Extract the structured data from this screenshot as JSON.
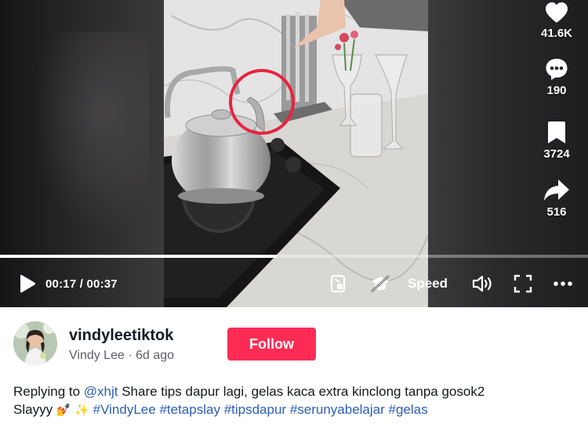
{
  "video": {
    "elapsed": "00:17",
    "separator": " / ",
    "duration": "00:37",
    "progress": 0.47,
    "speed_label": "Speed"
  },
  "actions": {
    "likes": "41.6K",
    "comments": "190",
    "saves": "3724",
    "shares": "516"
  },
  "author": {
    "username": "vindyleetiktok",
    "display_name": "Vindy Lee",
    "dot": " · ",
    "posted": "6d ago",
    "follow_label": "Follow"
  },
  "caption": {
    "reply_prefix": "Replying to ",
    "mention": "@xhjt",
    "text_line1": " Share tips dapur lagi, gelas kaca extra kinclong tanpa gosok2",
    "text_line2": "Slayyy",
    "emojis": "💅 ✨",
    "hashtags": [
      "#VindyLee",
      "#tetapslay",
      "#tipsdapur",
      "#serunyabelajar",
      "#gelas"
    ]
  },
  "colors": {
    "follow_bg": "#fe2c55",
    "link": "#2b5db9",
    "highlight_circle": "#e8233f"
  },
  "icons": {
    "like": "heart-icon",
    "comment": "comment-icon",
    "save": "bookmark-icon",
    "share": "share-icon",
    "play": "play-icon",
    "pip": "picture-in-picture-icon",
    "mute_graduation": "graduation-cap-icon",
    "volume": "volume-icon",
    "fullscreen": "fullscreen-icon",
    "more": "more-icon"
  }
}
